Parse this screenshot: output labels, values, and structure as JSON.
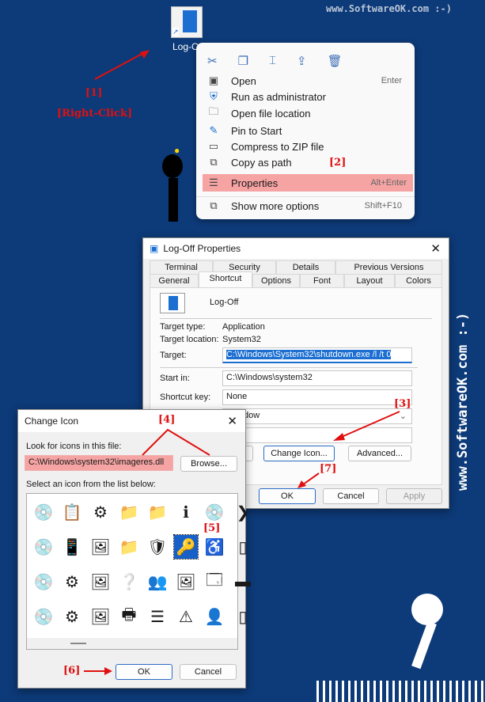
{
  "watermark": {
    "top": "www.SoftwareOK.com :-)",
    "side": "www.SoftwareOK.com :-)"
  },
  "desktop": {
    "icon_label": "Log-Off"
  },
  "annotations": [
    "[1]",
    "[Right-Click]",
    "[2]",
    "[3]",
    "[4]",
    "[5]",
    "[6]",
    "[7]"
  ],
  "context_menu": {
    "toolbar": [
      "cut-icon",
      "copy-icon",
      "rename-icon",
      "share-icon",
      "delete-icon"
    ],
    "items": [
      {
        "label": "Open",
        "shortcut": "Enter",
        "icon": "open-icon"
      },
      {
        "label": "Run as administrator",
        "shortcut": "",
        "icon": "shield-icon"
      },
      {
        "label": "Open file location",
        "shortcut": "",
        "icon": "folder-icon"
      },
      {
        "label": "Pin to Start",
        "shortcut": "",
        "icon": "pin-icon"
      },
      {
        "label": "Compress to ZIP file",
        "shortcut": "",
        "icon": "zip-icon"
      },
      {
        "label": "Copy as path",
        "shortcut": "",
        "icon": "path-icon"
      },
      {
        "label": "Properties",
        "shortcut": "Alt+Enter",
        "icon": "properties-icon",
        "highlighted": true
      },
      {
        "label": "Show more options",
        "shortcut": "Shift+F10",
        "icon": "more-options-icon"
      }
    ]
  },
  "properties": {
    "title": "Log-Off Properties",
    "tabs_row1": [
      "Terminal",
      "Security",
      "Details",
      "Previous Versions"
    ],
    "tabs_row2": [
      "General",
      "Shortcut",
      "Options",
      "Font",
      "Layout",
      "Colors"
    ],
    "selected_tab": "Shortcut",
    "name": "Log-Off",
    "target_type_label": "Target type:",
    "target_type": "Application",
    "target_location_label": "Target location:",
    "target_location": "System32",
    "target_label": "Target:",
    "target": "C:\\Windows\\System32\\shutdown.exe /l /t 0",
    "start_in_label": "Start in:",
    "start_in": "C:\\Windows\\system32",
    "shortcut_key_label": "Shortcut key:",
    "shortcut_key": "None",
    "run_value": "l window",
    "change_icon": "Change Icon...",
    "advanced": "Advanced...",
    "ok": "OK",
    "cancel": "Cancel",
    "apply": "Apply"
  },
  "change_icon": {
    "title": "Change Icon",
    "look_label": "Look for icons in this file:",
    "file": "C:\\Windows\\system32\\imageres.dll",
    "browse": "Browse...",
    "select_label": "Select an icon from the list below:",
    "ok": "OK",
    "cancel": "Cancel",
    "icons": [
      [
        "cd-icon",
        "document-icon",
        "settings-file-icon",
        "network-folder-icon",
        "font-folder-icon",
        "info-icon",
        "music-cd-icon",
        "close-x-icon"
      ],
      [
        "cd-r-icon",
        "phone-icon",
        "picture-icon",
        "network-folder-icon",
        "uac-shield-icon",
        "key-icon",
        "accessibility-icon",
        "doc-icon"
      ],
      [
        "cd-rom-icon",
        "settings-file-icon",
        "picture-icon",
        "drive-help-icon",
        "users-icon",
        "picture-icon",
        "window-cd-icon",
        "drive-icon"
      ],
      [
        "cd-rw-icon",
        "settings-window-icon",
        "picture-icon",
        "printer-icon",
        "server-icon",
        "warning-icon",
        "user-icon",
        "device-icon"
      ]
    ],
    "selected_icon": "key-icon"
  }
}
